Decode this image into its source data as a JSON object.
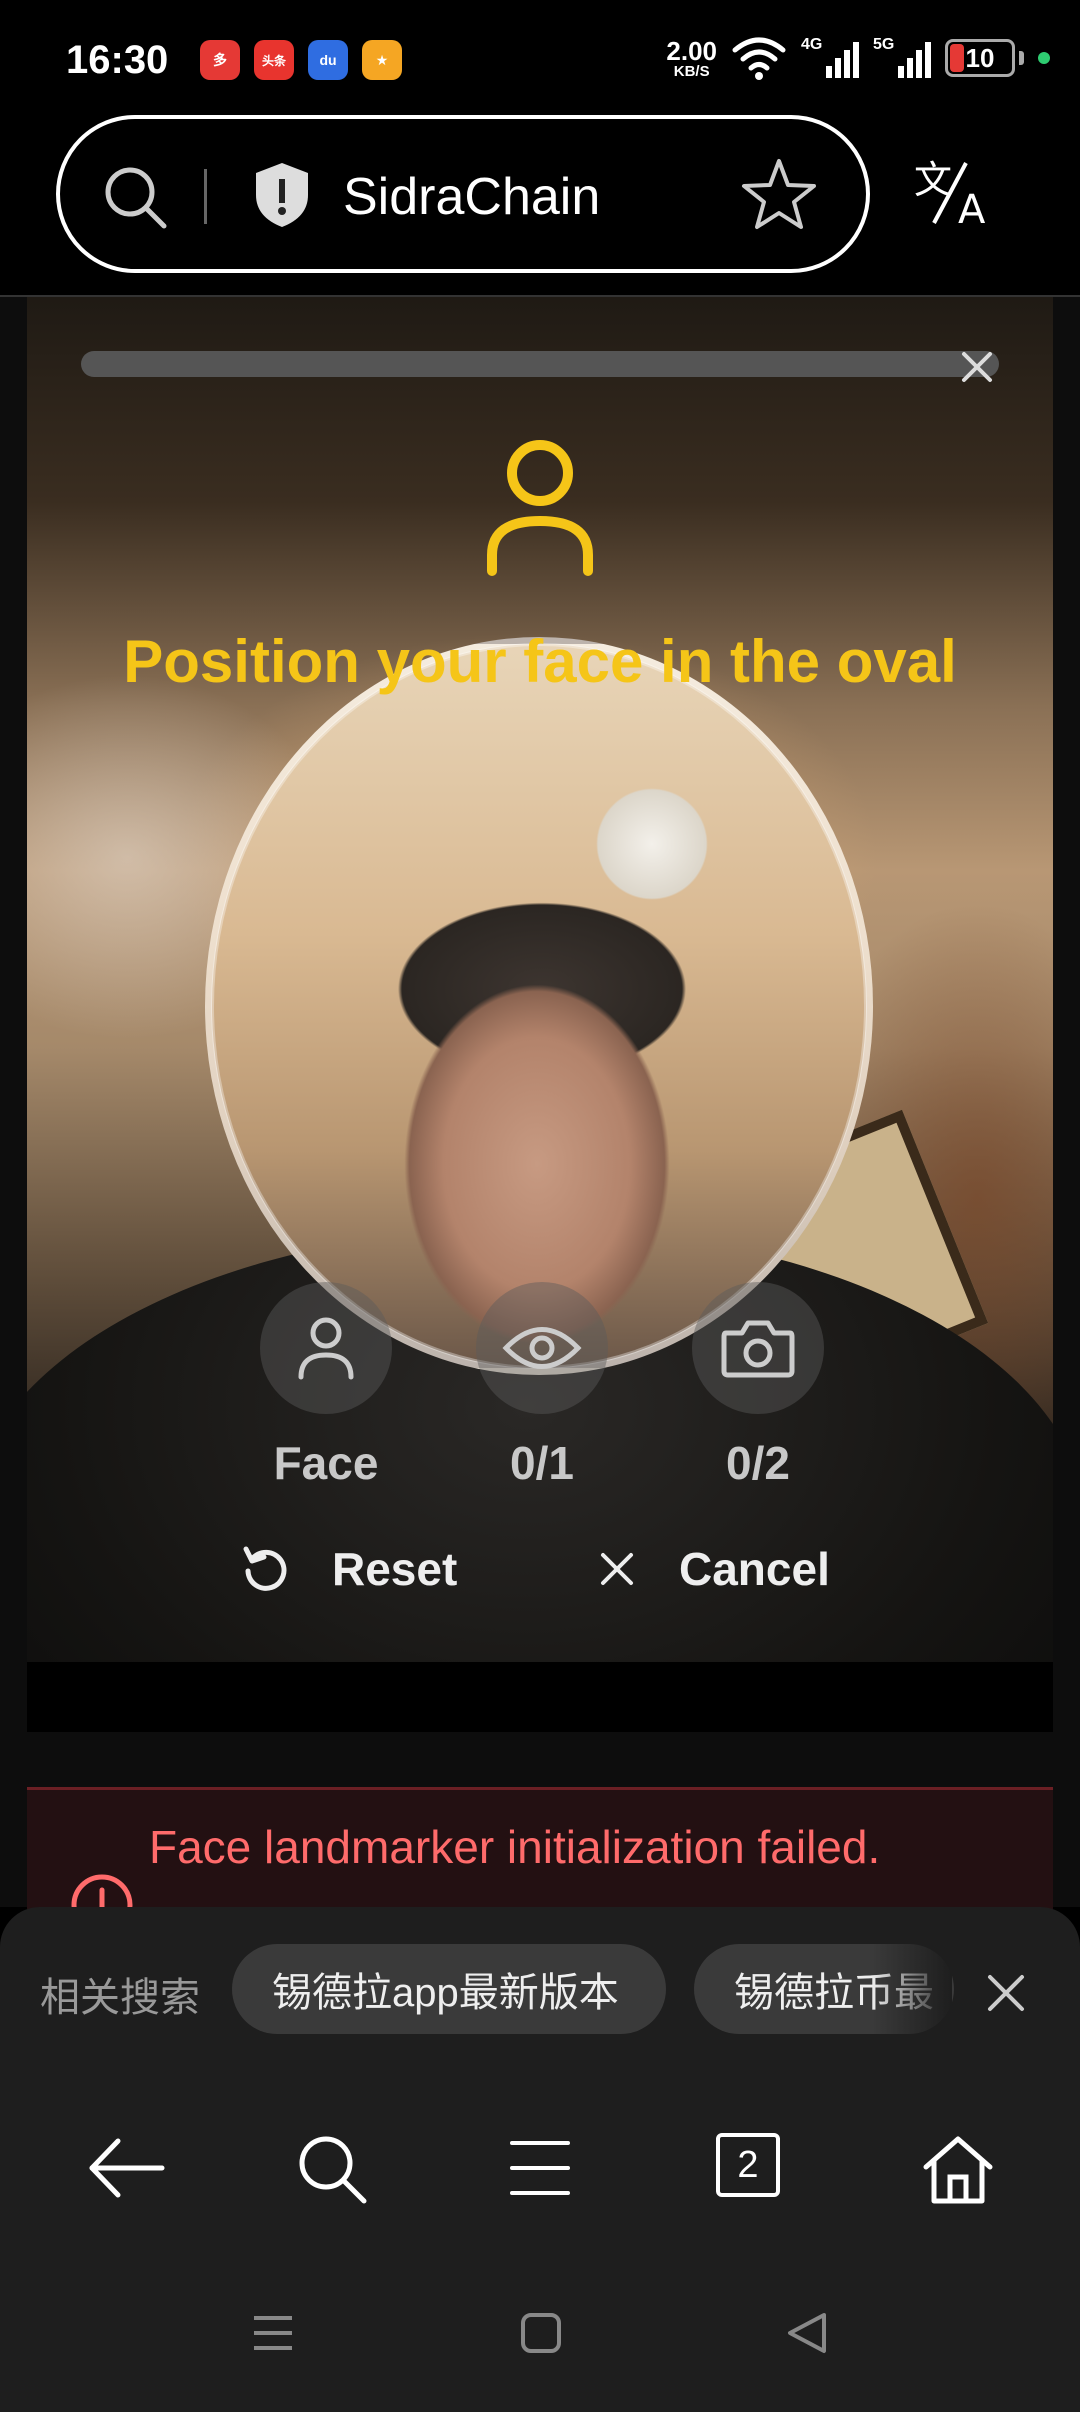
{
  "status_bar": {
    "time": "16:30",
    "app_icons": [
      {
        "name": "pinduoduo-icon",
        "color": "#e53935",
        "glyph": "多"
      },
      {
        "name": "toutiao-icon",
        "color": "#e8342e",
        "glyph": "头条"
      },
      {
        "name": "baidu-icon",
        "color": "#2f6de1",
        "glyph": "du"
      },
      {
        "name": "game-icon",
        "color": "#f5a623",
        "glyph": "★"
      }
    ],
    "net_speed_value": "2.00",
    "net_speed_unit": "KB/S",
    "signal1_label": "4G",
    "signal2_label": "5G",
    "battery": "10"
  },
  "browser": {
    "url_title": "SidraChain"
  },
  "face_verification": {
    "instruction": "Position your face in the oval",
    "steps": [
      {
        "label": "Face",
        "icon": "person-icon"
      },
      {
        "label": "0/1",
        "icon": "eye-icon"
      },
      {
        "label": "0/2",
        "icon": "camera-icon"
      }
    ],
    "reset_label": "Reset",
    "cancel_label": "Cancel"
  },
  "error": {
    "message": "Face landmarker initialization failed."
  },
  "related_search": {
    "label": "相关搜索",
    "chips": [
      "锡德拉app最新版本",
      "锡德拉币最"
    ]
  },
  "bottom_nav": {
    "tab_count": "2"
  },
  "colors": {
    "accent_yellow": "#f5c518",
    "error_red": "#ff6b6b"
  }
}
